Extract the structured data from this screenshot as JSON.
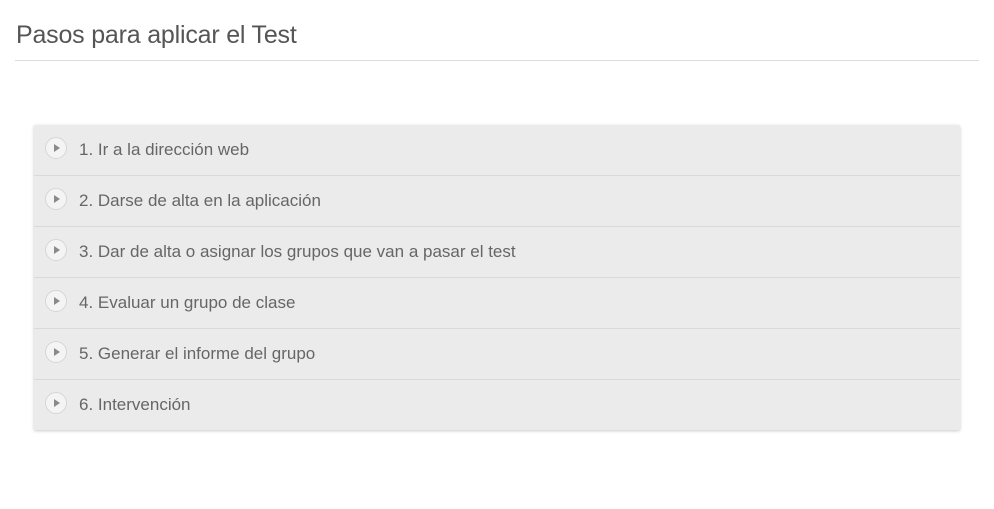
{
  "header": {
    "title": "Pasos para aplicar el Test"
  },
  "steps": [
    {
      "label": "1. Ir a la dirección web",
      "icon": "play-triangle-icon"
    },
    {
      "label": "2. Darse de alta en la aplicación",
      "icon": "play-triangle-icon"
    },
    {
      "label": "3. Dar de alta o asignar los grupos que van a pasar el test",
      "icon": "play-triangle-icon"
    },
    {
      "label": "4. Evaluar un grupo de clase",
      "icon": "play-triangle-icon"
    },
    {
      "label": "5. Generar el informe del grupo",
      "icon": "play-triangle-icon"
    },
    {
      "label": "6. Intervención",
      "icon": "play-triangle-icon"
    }
  ],
  "colors": {
    "accordion_background": "#ebebeb",
    "text": "#666666",
    "title": "#555555"
  }
}
